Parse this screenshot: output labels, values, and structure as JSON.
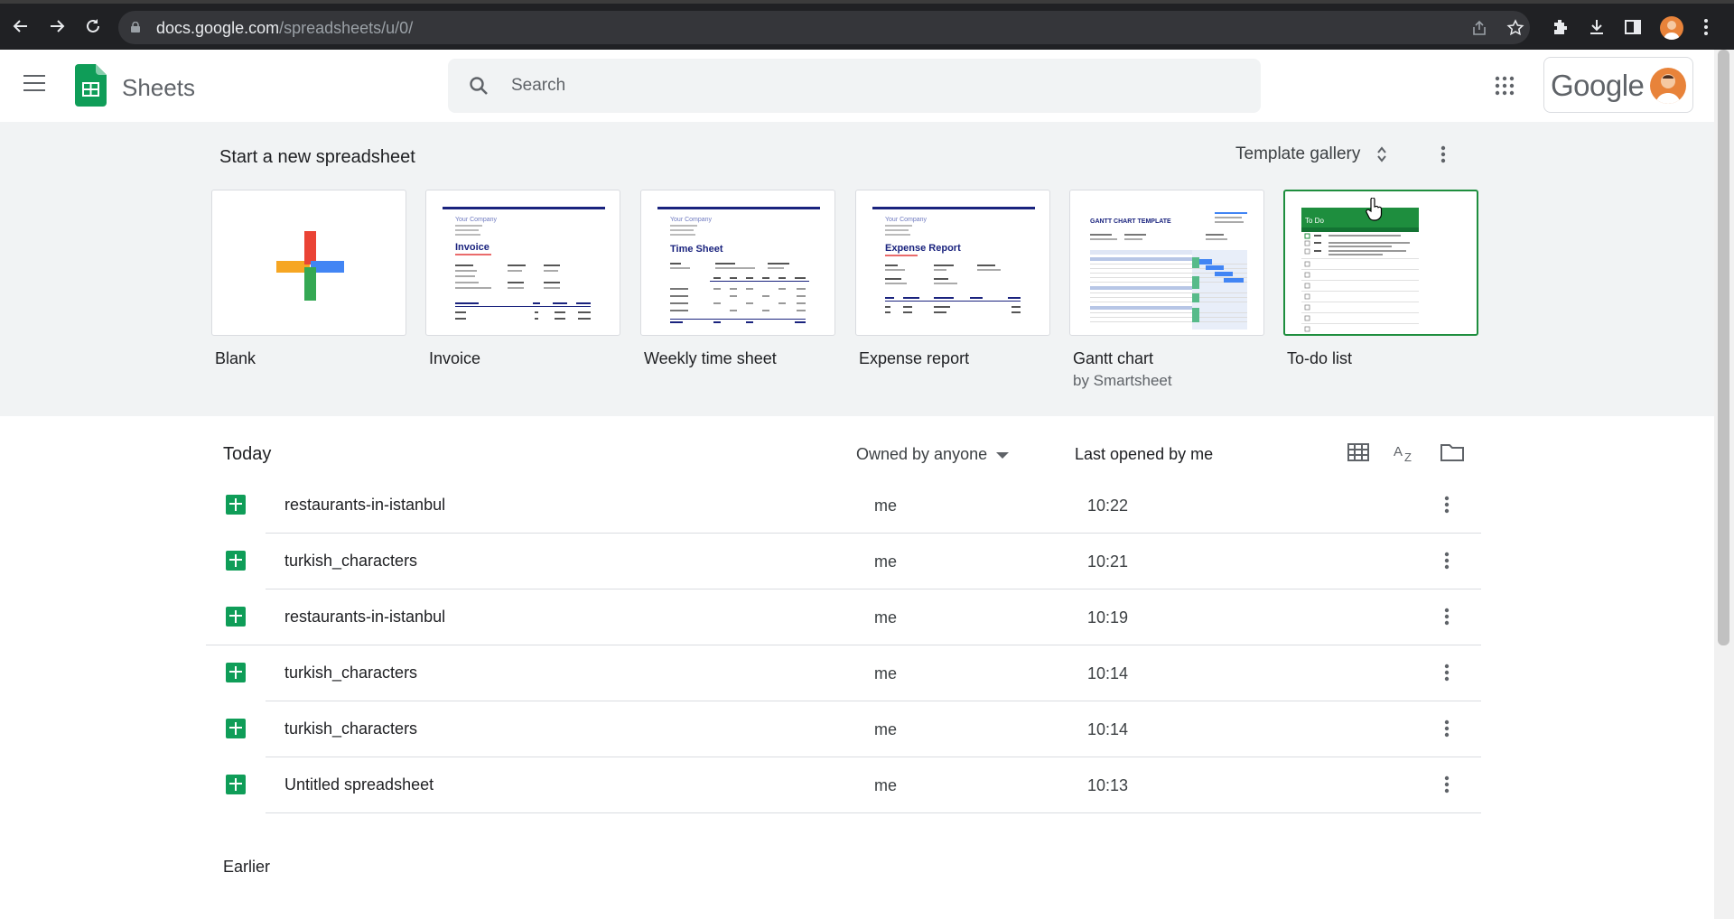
{
  "browser": {
    "url_host": "docs.google.com",
    "url_path": "/spreadsheets/u/0/"
  },
  "header": {
    "app_name": "Sheets",
    "search_placeholder": "Search",
    "brand": "Google"
  },
  "templates": {
    "heading": "Start a new spreadsheet",
    "gallery_label": "Template gallery",
    "items": [
      {
        "name": "Blank",
        "sub": ""
      },
      {
        "name": "Invoice",
        "sub": ""
      },
      {
        "name": "Weekly time sheet",
        "sub": ""
      },
      {
        "name": "Expense report",
        "sub": ""
      },
      {
        "name": "Gantt chart",
        "sub": "by Smartsheet"
      },
      {
        "name": "To-do list",
        "sub": ""
      }
    ],
    "thumb_text": {
      "company": "Your Company",
      "invoice": "Invoice",
      "time_sheet": "Time Sheet",
      "expense": "Expense Report",
      "gantt": "GANTT CHART TEMPLATE",
      "todo": "To Do"
    }
  },
  "files": {
    "section_label": "Today",
    "owner_filter": "Owned by anyone",
    "sort_label": "Last opened by me",
    "rows": [
      {
        "name": "restaurants-in-istanbul",
        "owner": "me",
        "time": "10:22"
      },
      {
        "name": "turkish_characters",
        "owner": "me",
        "time": "10:21"
      },
      {
        "name": "restaurants-in-istanbul",
        "owner": "me",
        "time": "10:19"
      },
      {
        "name": "turkish_characters",
        "owner": "me",
        "time": "10:14"
      },
      {
        "name": "turkish_characters",
        "owner": "me",
        "time": "10:14"
      },
      {
        "name": "Untitled spreadsheet",
        "owner": "me",
        "time": "10:13"
      }
    ],
    "earlier_label": "Earlier"
  },
  "colors": {
    "sheets_green": "#0f9d58",
    "selected_border": "#1e8e3e",
    "section_bg": "#f1f3f4"
  }
}
